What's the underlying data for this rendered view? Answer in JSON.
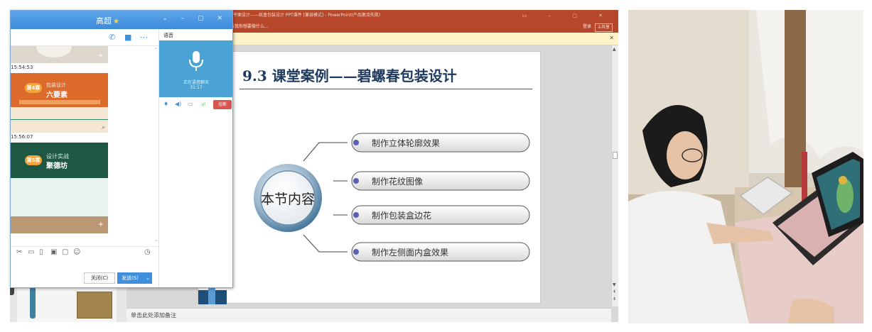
{
  "ppt": {
    "title_text": "平面设计——纸盒包装设计 PPT课件 [兼容模式] - PowerPoint(产品激活失败)",
    "tell_me": "告诉我你想要做什么...",
    "login": "登录",
    "share": "共享",
    "notes_placeholder": "单击此处添加备注",
    "slide": {
      "title": "9.3  课堂案例——碧螺春包装设计",
      "center_label": "本节内容",
      "items": [
        "制作立体轮廓效果",
        "制作花纹图像",
        "制作包装盒边花",
        "制作左侧面内盒效果"
      ]
    }
  },
  "chat": {
    "contact_name": "高超",
    "star": "★",
    "times": [
      "15:54:53",
      "15:56:07"
    ],
    "card2": {
      "badge": "第4章",
      "subtitle": "包装设计",
      "title": "六要素"
    },
    "card3": {
      "badge": "第5章",
      "subtitle": "设计实战",
      "title": "聚德坊"
    },
    "close_button": "关闭(C)",
    "send_button": "发送(S)",
    "voice": {
      "label": "语音",
      "status": "正在语音聊天",
      "timer": "31:17",
      "hangup": "挂断"
    }
  }
}
